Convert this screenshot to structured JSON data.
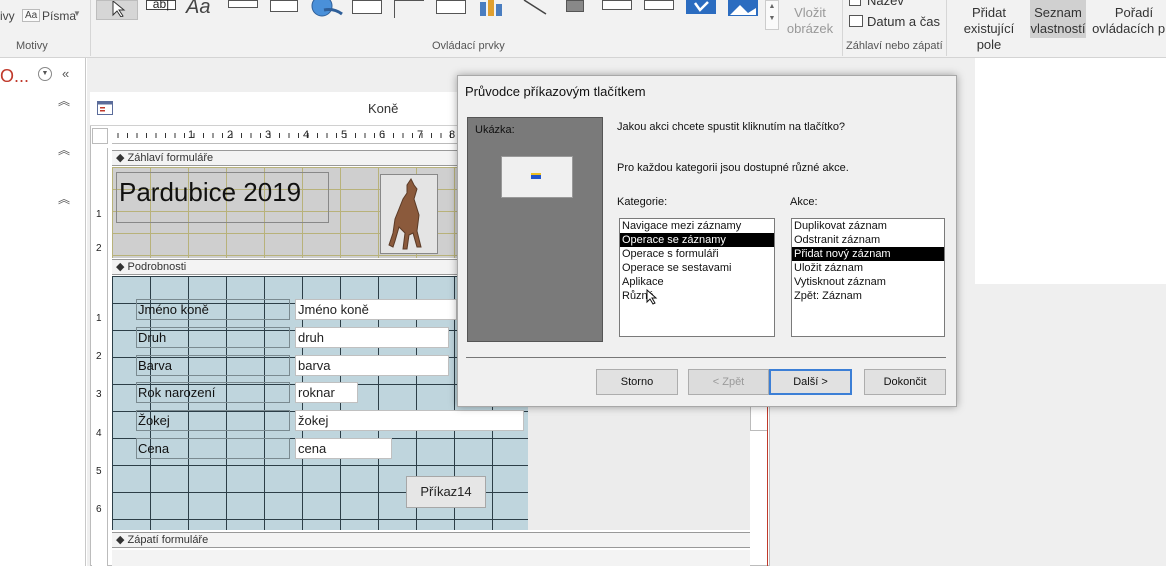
{
  "ribbon": {
    "themes_fragment": "ivy",
    "fonts_label": "Písma",
    "themes_group": "Motivy",
    "controls_group": "Ovládací prvky",
    "insert_image": "Vložit obrázek",
    "insert_image_line1": "Vložit",
    "insert_image_line2": "obrázek",
    "title_item": "Název",
    "date_time": "Datum a čas",
    "header_footer_group": "Záhlaví nebo zápatí",
    "add_fields_line1": "Přidat",
    "add_fields_line2": "existující pole",
    "property_sheet_line1": "Seznam",
    "property_sheet_line2": "vlastností",
    "tab_order_line1": "Pořadí",
    "tab_order_line2": "ovládacích prv"
  },
  "nav": {
    "truncated_title": "O..."
  },
  "form": {
    "tab_title": "Koně",
    "ruler_numbers": [
      "1",
      "2",
      "3",
      "4",
      "5",
      "6",
      "7",
      "8"
    ],
    "vruler_numbers_header": [
      "1",
      "2"
    ],
    "vruler_numbers_detail": [
      "1",
      "2",
      "3",
      "4",
      "5",
      "6"
    ],
    "header_section": "Záhlaví formuláře",
    "header_title": "Pardubice 2019",
    "detail_section": "Podrobnosti",
    "footer_section": "Zápatí formuláře",
    "labels": [
      "Jméno koně",
      "Druh",
      "Barva",
      "Rok narození",
      "Žokej",
      "Cena"
    ],
    "fields": [
      "Jméno koně",
      "druh",
      "barva",
      "roknar",
      "žokej",
      "cena"
    ],
    "command_button": "Příkaz14"
  },
  "dialog": {
    "title": "Průvodce příkazovým tlačítkem",
    "preview_label": "Ukázka:",
    "question": "Jakou akci chcete spustit kliknutím na tlačítko?",
    "info": "Pro každou kategorii jsou dostupné různé akce.",
    "categories_label": "Kategorie:",
    "actions_label": "Akce:",
    "categories": [
      "Navigace mezi záznamy",
      "Operace se záznamy",
      "Operace s formuláři",
      "Operace se sestavami",
      "Aplikace",
      "Různé"
    ],
    "selected_category": "Operace se záznamy",
    "actions": [
      "Duplikovat záznam",
      "Odstranit záznam",
      "Přidat nový záznam",
      "Uložit záznam",
      "Vytisknout záznam",
      "Zpět: Záznam"
    ],
    "selected_action": "Přidat nový záznam",
    "buttons": {
      "cancel": "Storno",
      "back": "< Zpět",
      "next": "Další >",
      "finish": "Dokončit"
    }
  }
}
